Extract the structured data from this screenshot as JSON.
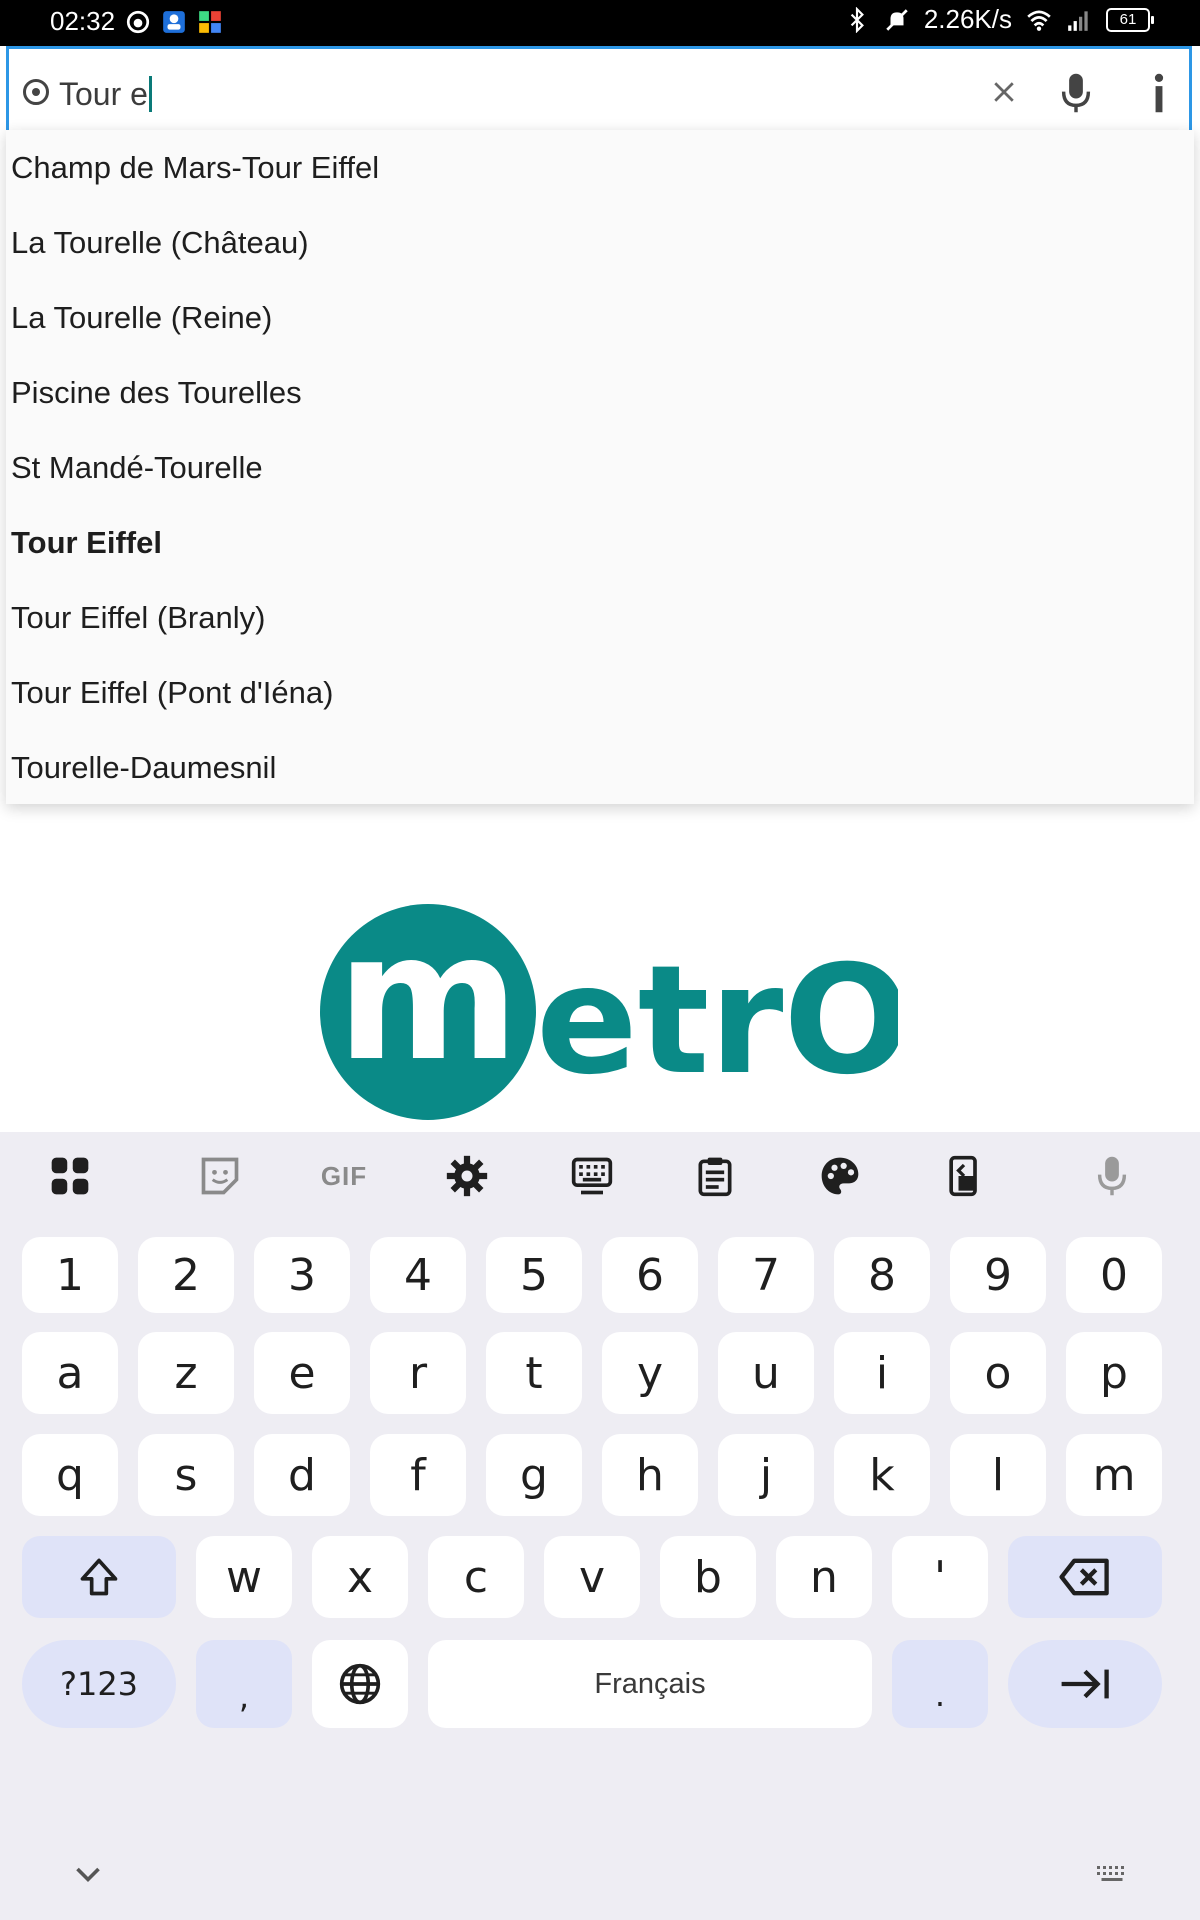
{
  "status_bar": {
    "time": "02:32",
    "network_speed": "2.26K/s",
    "battery": "61"
  },
  "search": {
    "query": "Tour e"
  },
  "suggestions": [
    {
      "label": "Champ de Mars-Tour Eiffel",
      "bold": false
    },
    {
      "label": "La Tourelle (Château)",
      "bold": false
    },
    {
      "label": "La Tourelle (Reine)",
      "bold": false
    },
    {
      "label": "Piscine des Tourelles",
      "bold": false
    },
    {
      "label": "St Mandé-Tourelle",
      "bold": false
    },
    {
      "label": "Tour Eiffel",
      "bold": true
    },
    {
      "label": "Tour Eiffel (Branly)",
      "bold": false
    },
    {
      "label": "Tour Eiffel (Pont d'Iéna)",
      "bold": false
    },
    {
      "label": "Tourelle-Daumesnil",
      "bold": false
    }
  ],
  "logo": {
    "m": "m",
    "rest": "etrO",
    "color": "#0a8a87"
  },
  "keyboard": {
    "toolbar_gif": "GIF",
    "row_numbers": [
      "1",
      "2",
      "3",
      "4",
      "5",
      "6",
      "7",
      "8",
      "9",
      "0"
    ],
    "row1": [
      "a",
      "z",
      "e",
      "r",
      "t",
      "y",
      "u",
      "i",
      "o",
      "p"
    ],
    "row2": [
      "q",
      "s",
      "d",
      "f",
      "g",
      "h",
      "j",
      "k",
      "l",
      "m"
    ],
    "row3": [
      "w",
      "x",
      "c",
      "v",
      "b",
      "n",
      "'"
    ],
    "symbols_label": "?123",
    "comma": ",",
    "period": ".",
    "space_label": "Français",
    "accent_fn": "#dfe3f8"
  }
}
